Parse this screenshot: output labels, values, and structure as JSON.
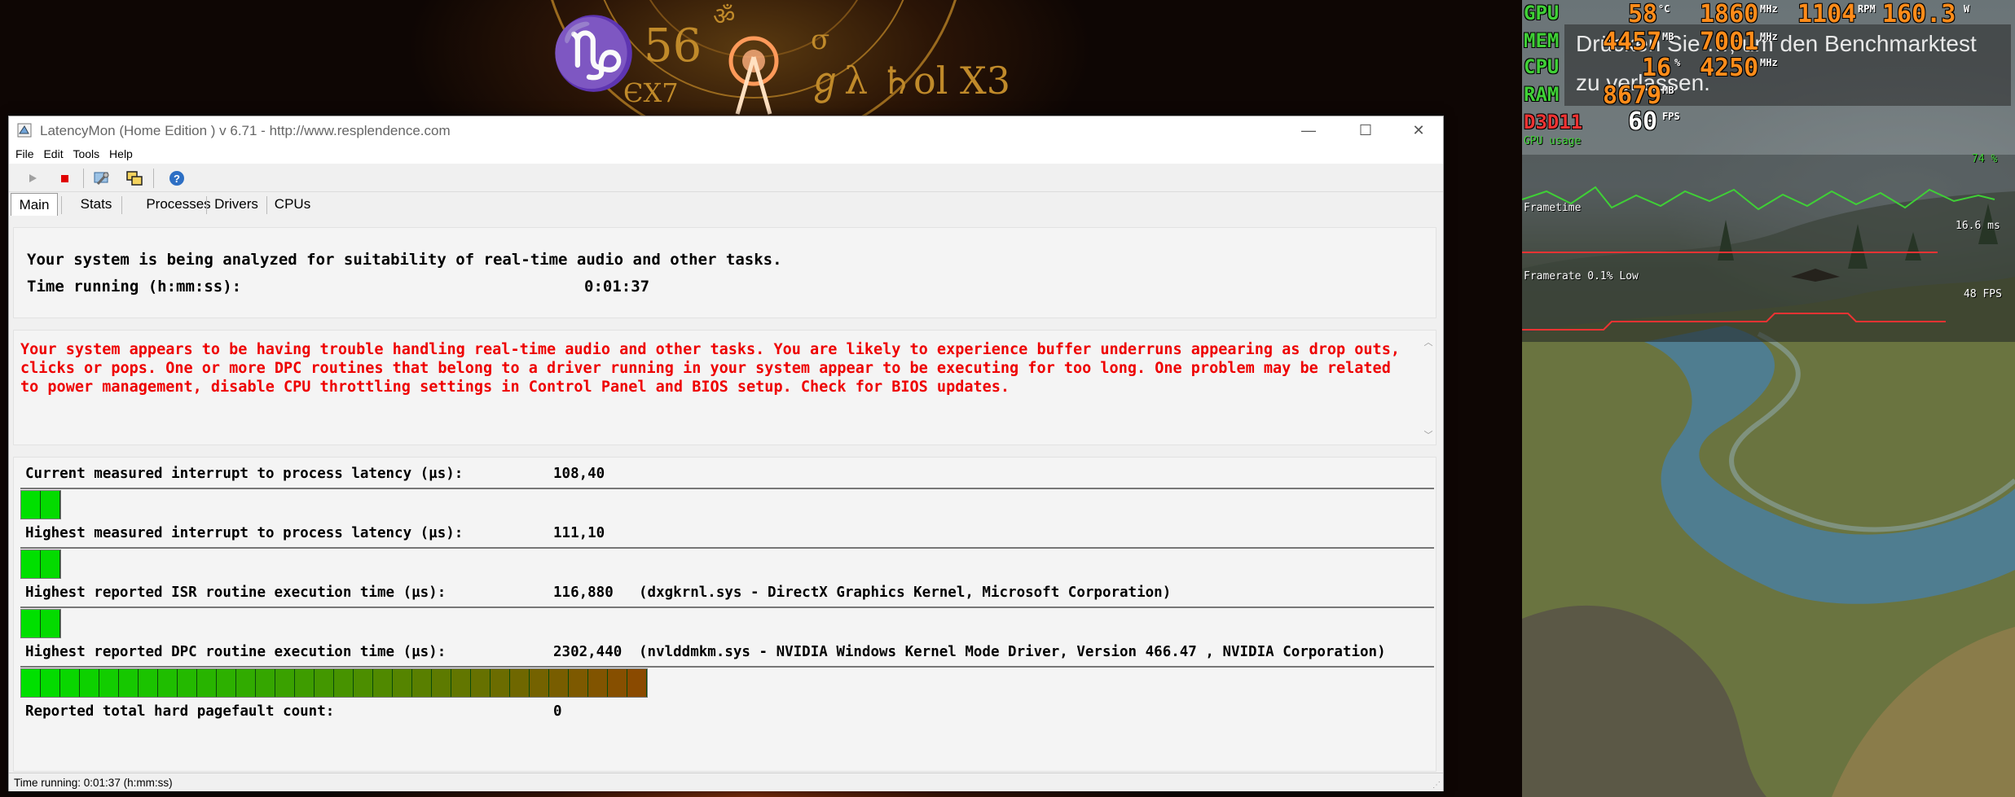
{
  "window": {
    "title": "LatencyMon  (Home Edition )  v 6.71 - http://www.resplendence.com",
    "minimize": "—",
    "maximize": "☐",
    "close": "✕"
  },
  "menu": [
    "File",
    "Edit",
    "Tools",
    "Help"
  ],
  "toolbar_icons": [
    "play-icon",
    "stop-icon",
    "tools-icon",
    "windows-icon",
    "help-icon"
  ],
  "tabs": [
    "Main",
    "Stats",
    "Processes",
    "Drivers",
    "CPUs"
  ],
  "status_panel": {
    "intro": "Your system is being analyzed for suitability of real-time audio and other tasks.",
    "time_label": "Time running (h:mm:ss):",
    "time_value": "0:01:37"
  },
  "warning": "Your system appears to be having trouble handling real-time audio and other tasks. You are likely to experience buffer underruns appearing as drop outs, clicks or pops. One or more DPC routines that belong to a driver running in your system appear to be executing for too long. One problem may be related to power management, disable CPU throttling settings in Control Panel and BIOS setup. Check for BIOS updates.",
  "metrics": [
    {
      "label": "Current measured interrupt to process latency (µs):",
      "value": "108,40",
      "detail": "",
      "bar_segments": 2
    },
    {
      "label": "Highest measured interrupt to process latency (µs):",
      "value": "111,10",
      "detail": "",
      "bar_segments": 2
    },
    {
      "label": "Highest reported ISR routine execution time (µs):",
      "value": "116,880",
      "detail": "(dxgkrnl.sys - DirectX Graphics Kernel, Microsoft Corporation)",
      "bar_segments": 2
    },
    {
      "label": "Highest reported DPC routine execution time (µs):",
      "value": "2302,440",
      "detail": "(nvlddmkm.sys - NVIDIA Windows Kernel Mode Driver, Version 466.47 , NVIDIA Corporation)",
      "bar_segments": 32
    },
    {
      "label": "Reported total hard pagefault count:",
      "value": "0",
      "detail": "",
      "bar_segments": 0
    }
  ],
  "statusbar": "Time running: 0:01:37  (h:mm:ss)",
  "background_glyphs": "♑ 56 ॐ σ ℊλ ♄ol X3 ЄX7",
  "osd": {
    "gpu": {
      "label": "GPU",
      "temp": "58",
      "temp_unit": "°C",
      "clock": "1860",
      "clock_unit": "MHz",
      "fan": "1104",
      "fan_unit": "RPM",
      "power": "160.3",
      "power_unit": "W"
    },
    "mem": {
      "label": "MEM",
      "used": "4457",
      "used_unit": "MB",
      "clock": "7001",
      "clock_unit": "MHz"
    },
    "cpu": {
      "label": "CPU",
      "usage": "16",
      "usage_unit": "%",
      "clock": "4250",
      "clock_unit": "MHz"
    },
    "ram": {
      "label": "RAM",
      "used": "8679",
      "used_unit": "MB"
    },
    "api": {
      "label": "D3D11",
      "fps": "60",
      "fps_unit": "FPS"
    },
    "graphs": [
      {
        "label": "GPU usage",
        "value": "74 %"
      },
      {
        "label": "Frametime",
        "value": "16.6 ms"
      },
      {
        "label": "Framerate 0.1% Low",
        "value": "48 FPS"
      }
    ],
    "bench_note": "Drücken Sie …, um den Benchmarktest zu verlassen."
  },
  "colors": {
    "warning": "#ee0000",
    "bar_green": "#00e000",
    "bar_brown": "#8a4a00",
    "osd_label": "#3fd036",
    "osd_value": "#ff8c1a"
  }
}
